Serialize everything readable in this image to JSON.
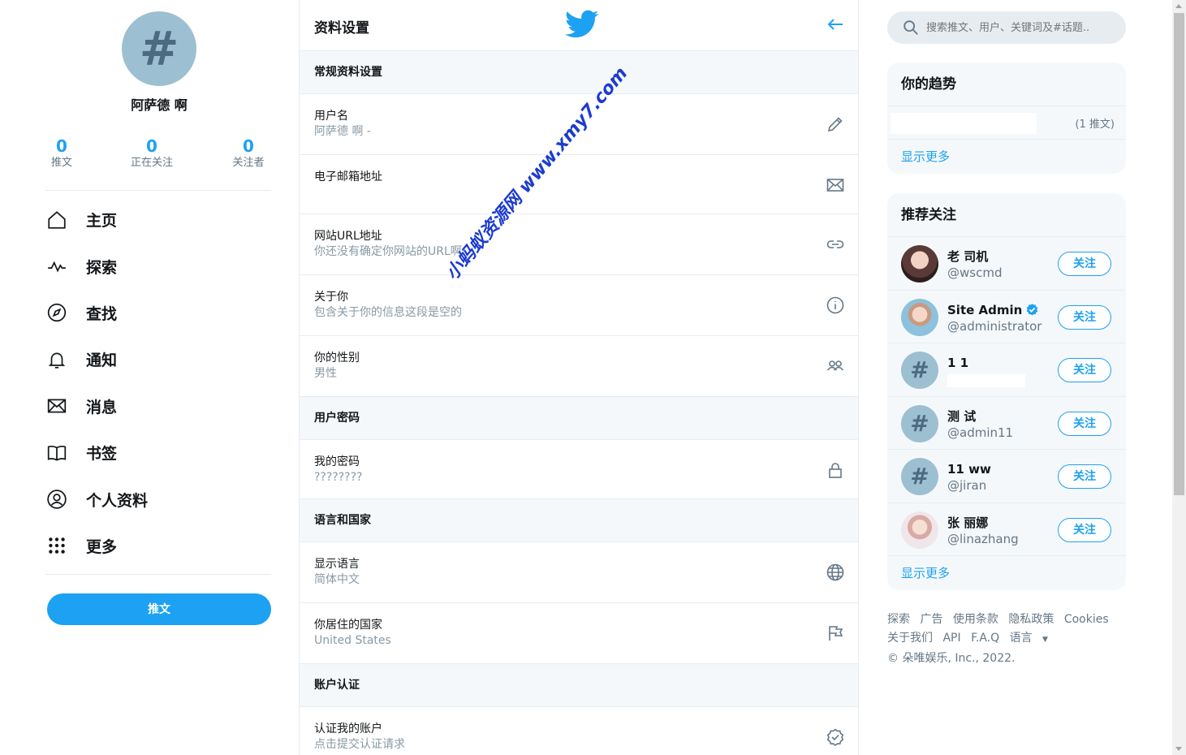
{
  "profile": {
    "avatar_glyph": "#",
    "name": "阿萨德 啊",
    "stats": [
      {
        "value": "0",
        "label": "推文"
      },
      {
        "value": "0",
        "label": "正在关注"
      },
      {
        "value": "0",
        "label": "关注者"
      }
    ]
  },
  "nav": [
    {
      "label": "主页",
      "icon": "home-icon"
    },
    {
      "label": "探索",
      "icon": "activity-icon"
    },
    {
      "label": "查找",
      "icon": "compass-icon"
    },
    {
      "label": "通知",
      "icon": "bell-icon"
    },
    {
      "label": "消息",
      "icon": "mail-icon"
    },
    {
      "label": "书签",
      "icon": "book-icon"
    },
    {
      "label": "个人资料",
      "icon": "user-icon"
    },
    {
      "label": "更多",
      "icon": "grid-dots-icon"
    }
  ],
  "tweet_button": "推文",
  "center": {
    "title": "资料设置",
    "sections": {
      "general": "常规资料设置",
      "password": "用户密码",
      "language": "语言和国家",
      "verify": "账户认证"
    },
    "rows": {
      "username": {
        "label": "用户名",
        "value": "阿萨德 啊 -"
      },
      "email": {
        "label": "电子邮箱地址",
        "value": ""
      },
      "website": {
        "label": "网站URL地址",
        "value": "你还没有确定你网站的URL啊"
      },
      "about": {
        "label": "关于你",
        "value": "包含关于你的信息这段是空的"
      },
      "gender": {
        "label": "你的性别",
        "value": "男性"
      },
      "password": {
        "label": "我的密码",
        "value": "????????"
      },
      "display_language": {
        "label": "显示语言",
        "value": "简体中文"
      },
      "country": {
        "label": "你居住的国家",
        "value": "United States"
      },
      "verify": {
        "label": "认证我的账户",
        "value": "点击提交认证请求"
      }
    }
  },
  "search": {
    "placeholder": "搜索推文、用户、关键词及#话题.."
  },
  "trends": {
    "title": "你的趋势",
    "count": "(1 推文)",
    "show_more": "显示更多"
  },
  "suggest": {
    "title": "推荐关注",
    "follow_label": "关注",
    "show_more": "显示更多",
    "users": [
      {
        "name": "老 司机",
        "handle": "@wscmd"
      },
      {
        "name": "Site Admin",
        "handle": "@administrator"
      },
      {
        "name": "1 1",
        "handle": ""
      },
      {
        "name": "测 试",
        "handle": "@admin11"
      },
      {
        "name": "11 ww",
        "handle": "@jiran"
      },
      {
        "name": "张 丽娜",
        "handle": "@linazhang"
      }
    ]
  },
  "footer": {
    "links1": [
      "探索",
      "广告",
      "使用条款",
      "隐私政策",
      "Cookies"
    ],
    "links2": [
      "关于我们",
      "API",
      "F.A.Q",
      "语言"
    ],
    "copyright": "© 朵唯娱乐, Inc., 2022."
  },
  "watermark": "小蚂蚁资源网 www.xmy7.com",
  "colors": {
    "accent": "#1da1f2",
    "avatar_bg": "#9dbfd2"
  }
}
